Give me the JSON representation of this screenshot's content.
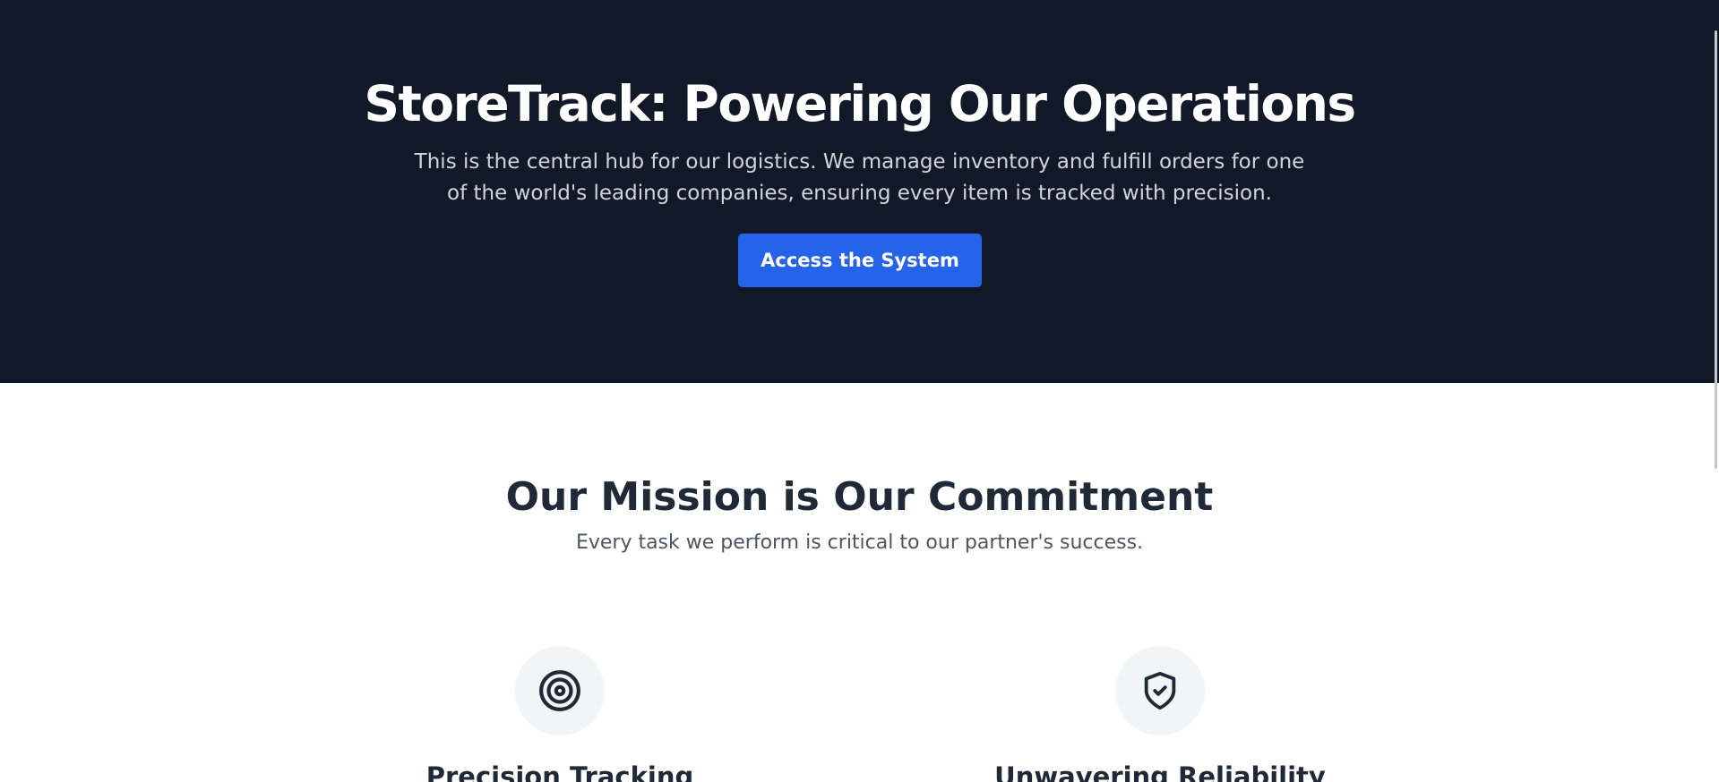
{
  "hero": {
    "title": "StoreTrack: Powering Our Operations",
    "description": "This is the central hub for our logistics. We manage inventory and fulfill orders for one of the world's leading companies, ensuring every item is tracked with precision.",
    "cta_label": "Access the System"
  },
  "mission": {
    "title": "Our Mission is Our Commitment",
    "subtitle": "Every task we perform is critical to our partner's success."
  },
  "features": [
    {
      "icon": "target-icon",
      "title": "Precision Tracking"
    },
    {
      "icon": "shield-check-icon",
      "title": "Unwavering Reliability"
    }
  ],
  "colors": {
    "hero_bg": "#111827",
    "accent": "#2563eb",
    "heading": "#1f2937",
    "icon_bg": "#f3f4f6"
  }
}
